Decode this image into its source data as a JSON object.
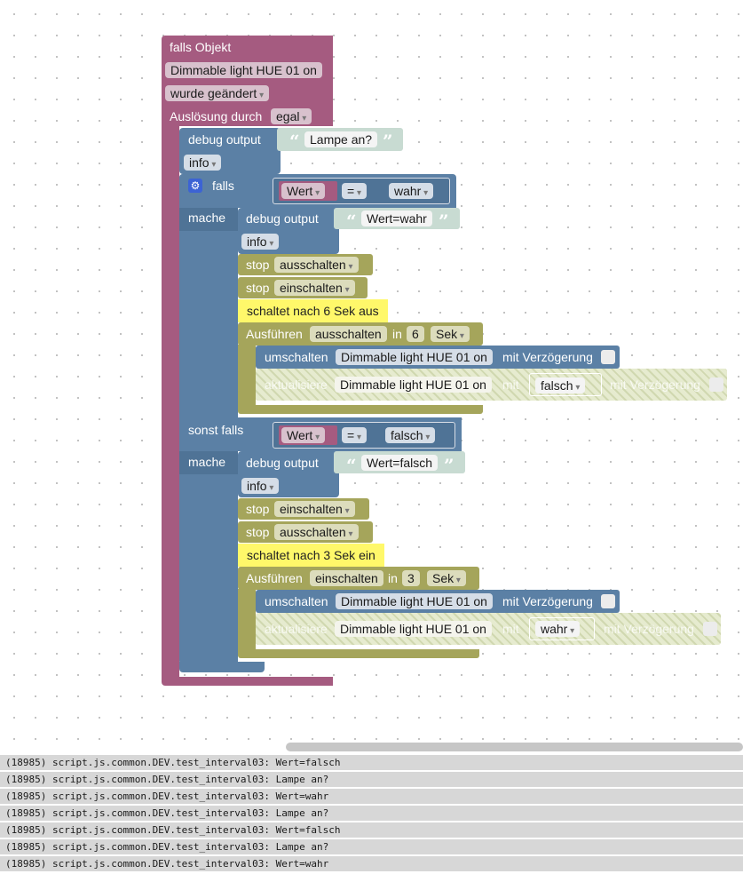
{
  "event_block": {
    "header": "falls Objekt",
    "object": "Dimmable light HUE 01 on",
    "change_mode": "wurde geändert",
    "trigger_label": "Auslösung durch",
    "trigger_value": "egal"
  },
  "debug_main": {
    "label": "debug output",
    "text": "Lampe an?",
    "level": "info"
  },
  "if_block": {
    "falls_label": "falls",
    "mache_label": "mache",
    "sonst_falls_label": "sonst falls",
    "condition1": {
      "var": "Wert",
      "op": "=",
      "value": "wahr"
    },
    "condition2": {
      "var": "Wert",
      "op": "=",
      "value": "falsch"
    }
  },
  "branch1": {
    "debug_label": "debug output",
    "debug_text": "Wert=wahr",
    "debug_level": "info",
    "stop1_label": "stop",
    "stop1_value": "ausschalten",
    "stop2_label": "stop",
    "stop2_value": "einschalten",
    "comment": "schaltet nach 6 Sek aus",
    "exec_label": "Ausführen",
    "exec_name": "ausschalten",
    "exec_in": "in",
    "exec_num": "6",
    "exec_unit": "Sek",
    "toggle_label": "umschalten",
    "toggle_object": "Dimmable light HUE 01 on",
    "toggle_delay": "mit Verzögerung",
    "update_label": "aktualisiere",
    "update_object": "Dimmable light HUE 01 on",
    "update_mit": "mit",
    "update_value": "falsch",
    "update_delay": "mit Verzögerung"
  },
  "branch2": {
    "debug_label": "debug output",
    "debug_text": "Wert=falsch",
    "debug_level": "info",
    "stop1_label": "stop",
    "stop1_value": "einschalten",
    "stop2_label": "stop",
    "stop2_value": "ausschalten",
    "comment": "schaltet nach 3 Sek ein",
    "exec_label": "Ausführen",
    "exec_name": "einschalten",
    "exec_in": "in",
    "exec_num": "3",
    "exec_unit": "Sek",
    "toggle_label": "umschalten",
    "toggle_object": "Dimmable light HUE 01 on",
    "toggle_delay": "mit Verzögerung",
    "update_label": "aktualisiere",
    "update_object": "Dimmable light HUE 01 on",
    "update_mit": "mit",
    "update_value": "wahr",
    "update_delay": "mit Verzögerung"
  },
  "log_lines": [
    "(18985) script.js.common.DEV.test_interval03: Wert=falsch",
    "(18985) script.js.common.DEV.test_interval03: Lampe an?",
    "(18985) script.js.common.DEV.test_interval03: Wert=wahr",
    "(18985) script.js.common.DEV.test_interval03: Lampe an?",
    "(18985) script.js.common.DEV.test_interval03: Wert=falsch",
    "(18985) script.js.common.DEV.test_interval03: Lampe an?",
    "(18985) script.js.common.DEV.test_interval03: Wert=wahr"
  ],
  "icons": {
    "gear": "gear-icon",
    "quote_open": "quote-open-icon",
    "quote_close": "quote-close-icon"
  },
  "colors": {
    "event": "#a55b80",
    "control": "#5b80a5",
    "timer": "#a5a55b",
    "text": "#c8dbd2",
    "comment": "#fff86a"
  }
}
